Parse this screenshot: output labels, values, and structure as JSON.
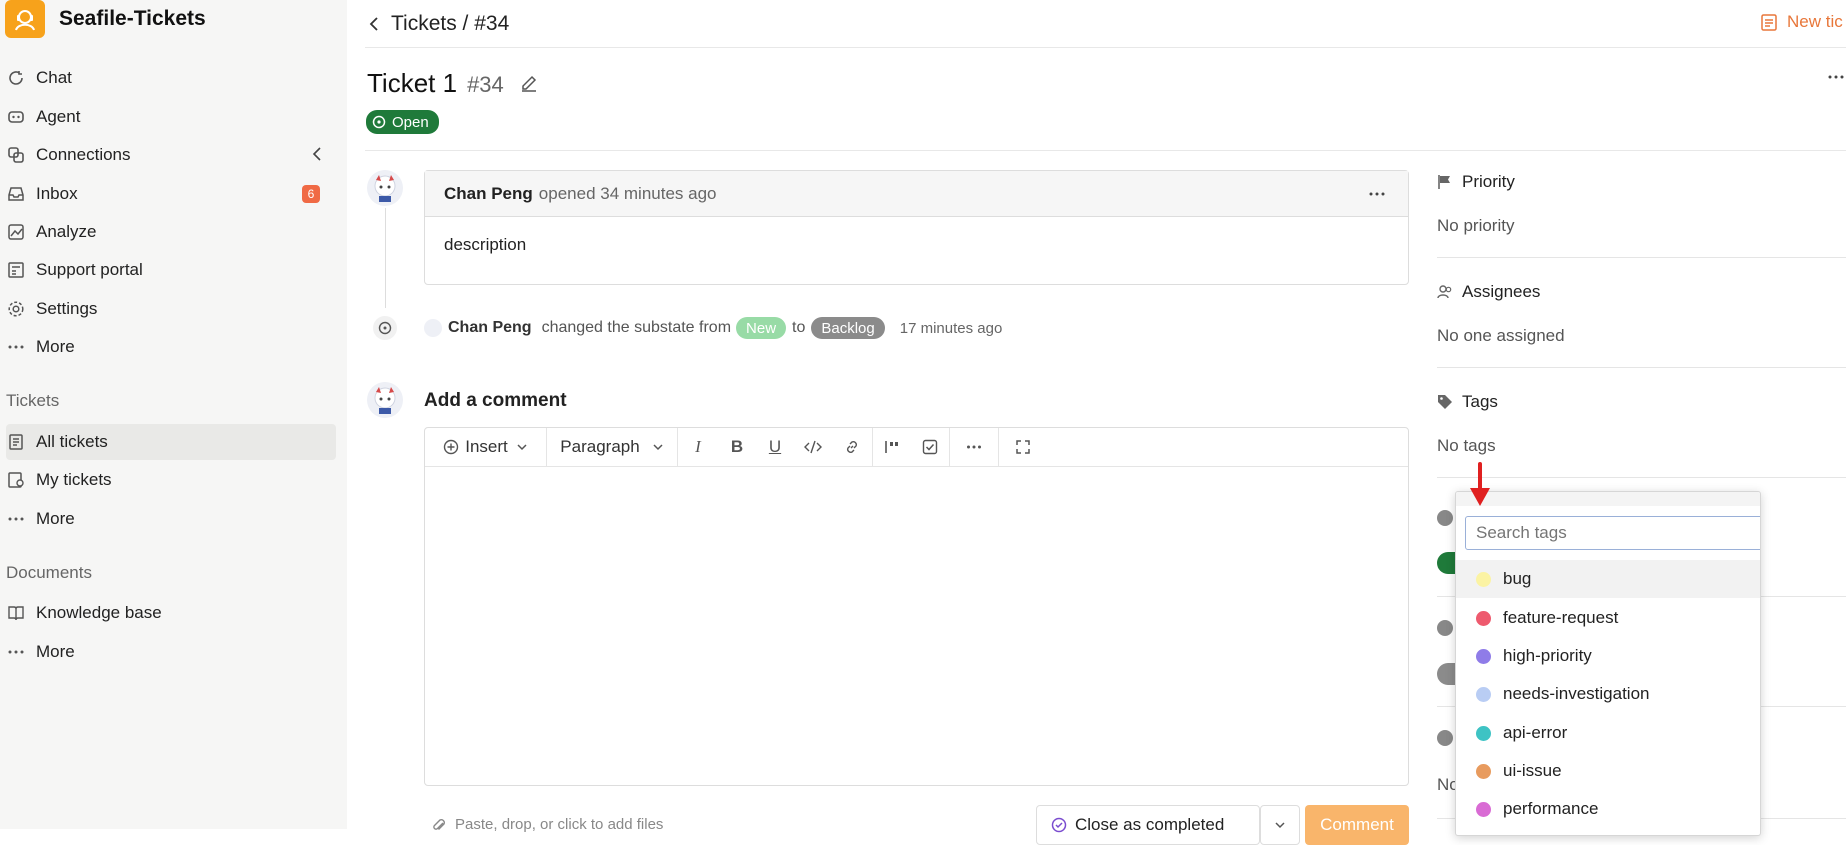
{
  "app": {
    "name": "Seafile-Tickets"
  },
  "sidebar": {
    "items": [
      {
        "label": "Chat",
        "icon": "chat-icon"
      },
      {
        "label": "Agent",
        "icon": "agent-icon"
      },
      {
        "label": "Connections",
        "icon": "connections-icon"
      },
      {
        "label": "Inbox",
        "icon": "inbox-icon",
        "badge": "6"
      },
      {
        "label": "Analyze",
        "icon": "analyze-icon"
      },
      {
        "label": "Support portal",
        "icon": "support-portal-icon"
      },
      {
        "label": "Settings",
        "icon": "settings-icon"
      },
      {
        "label": "More",
        "icon": "more-icon"
      }
    ],
    "tickets_section": {
      "label": "Tickets",
      "items": [
        {
          "label": "All tickets"
        },
        {
          "label": "My tickets"
        },
        {
          "label": "More"
        }
      ]
    },
    "documents_section": {
      "label": "Documents",
      "items": [
        {
          "label": "Knowledge base"
        },
        {
          "label": "More"
        }
      ]
    }
  },
  "header": {
    "breadcrumb": "Tickets / #34",
    "new_ticket_label": "New tic"
  },
  "ticket": {
    "title": "Ticket 1",
    "number": "#34",
    "status": "Open",
    "status_color": "#1f7a3a"
  },
  "timeline": {
    "opened": {
      "author": "Chan Peng",
      "action": "opened 34 minutes ago",
      "body": "description"
    },
    "event": {
      "author": "Chan Peng",
      "text": "changed the substate from",
      "from": "New",
      "to_word": "to",
      "to": "Backlog",
      "time": "17 minutes ago"
    }
  },
  "comment": {
    "heading": "Add a comment",
    "insert_label": "Insert",
    "paragraph_label": "Paragraph",
    "attach_hint": "Paste, drop, or click to add files",
    "close_label": "Close as completed",
    "submit_label": "Comment"
  },
  "right_panel": {
    "priority": {
      "label": "Priority",
      "value": "No priority"
    },
    "assignees": {
      "label": "Assignees",
      "value": "No one assigned"
    },
    "tags": {
      "label": "Tags",
      "value": "No tags"
    },
    "partial_text": "No"
  },
  "tag_dropdown": {
    "placeholder": "Search tags",
    "tags": [
      {
        "name": "bug",
        "color": "#fbf3a3"
      },
      {
        "name": "feature-request",
        "color": "#ee5a6e"
      },
      {
        "name": "high-priority",
        "color": "#8f7ce8"
      },
      {
        "name": "needs-investigation",
        "color": "#b9cdf4"
      },
      {
        "name": "api-error",
        "color": "#3ec3c4"
      },
      {
        "name": "ui-issue",
        "color": "#e89b5e"
      },
      {
        "name": "performance",
        "color": "#d96bd4"
      }
    ]
  },
  "colors": {
    "accent": "#f7a21b",
    "new_pill": "#98dba6",
    "backlog_pill": "#8b8b8b",
    "arrow": "#e02020"
  }
}
